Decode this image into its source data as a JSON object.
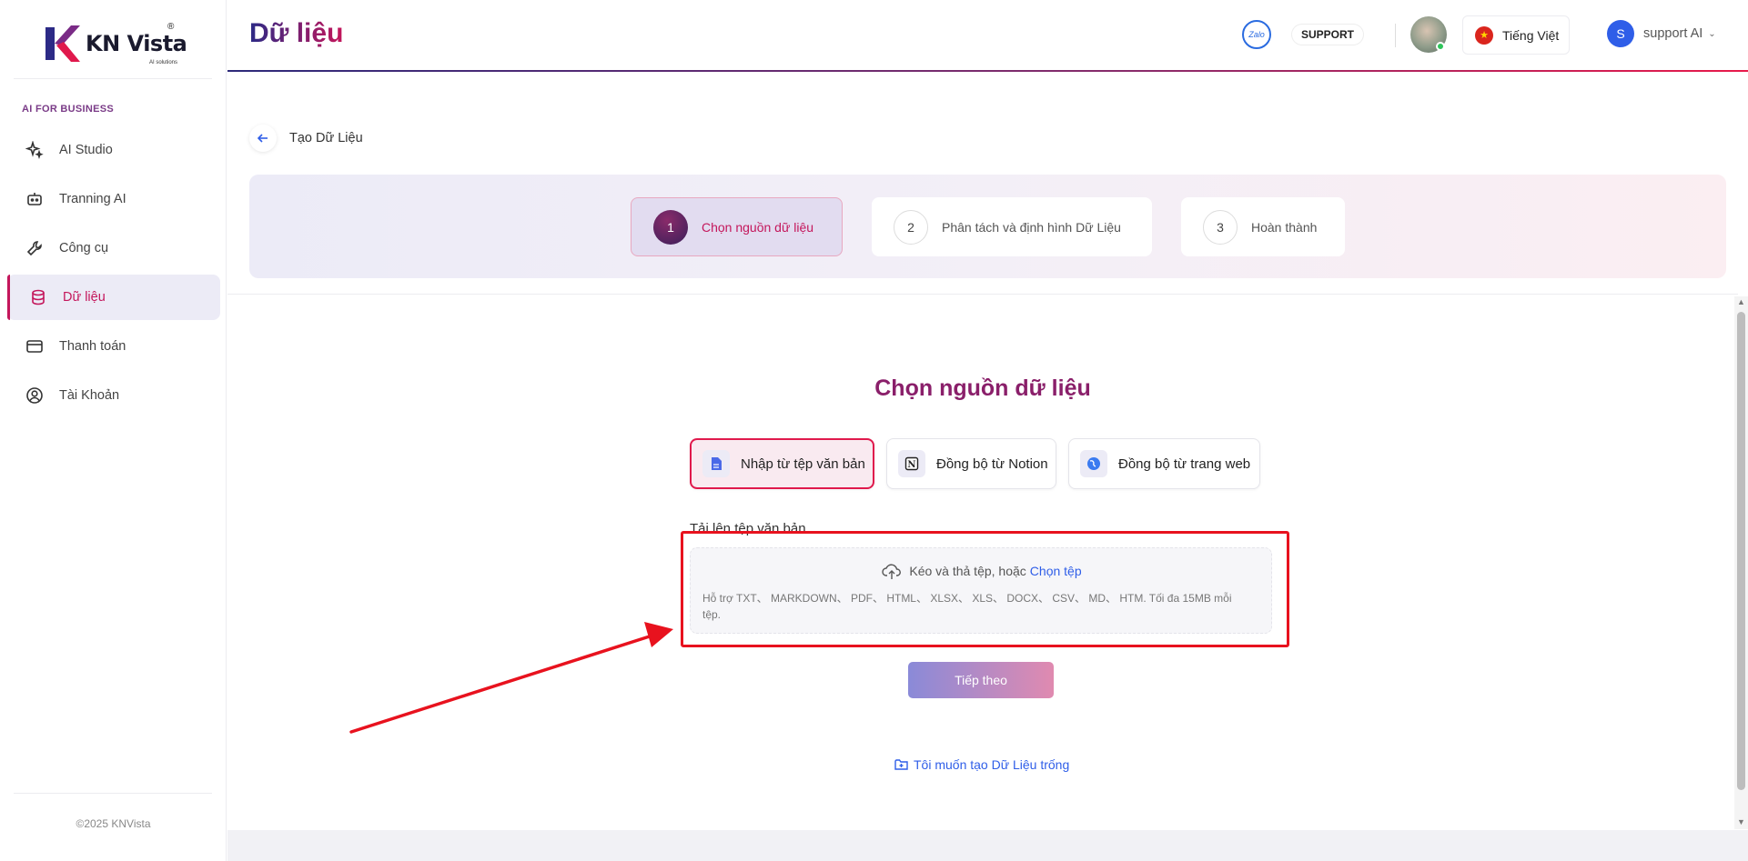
{
  "brand": {
    "name": "KN Vista",
    "tagline": "AI solutions",
    "reg": "®"
  },
  "sidebar": {
    "section_label": "AI FOR BUSINESS",
    "items": [
      {
        "label": "AI Studio",
        "icon": "sparkles-icon",
        "active": false
      },
      {
        "label": "Tranning AI",
        "icon": "robot-icon",
        "active": false
      },
      {
        "label": "Công cụ",
        "icon": "wrench-icon",
        "active": false
      },
      {
        "label": "Dữ liệu",
        "icon": "database-icon",
        "active": true
      },
      {
        "label": "Thanh toán",
        "icon": "credit-card-icon",
        "active": false
      },
      {
        "label": "Tài Khoản",
        "icon": "user-circle-icon",
        "active": false
      }
    ],
    "copyright": "©2025 KNVista"
  },
  "header": {
    "title": "Dữ liệu",
    "zalo_label": "Zalo",
    "support_label": "SUPPORT",
    "language": "Tiếng Việt",
    "user_initial": "S",
    "user_name": "support AI"
  },
  "page": {
    "back_label": "Tạo Dữ Liệu",
    "steps": [
      {
        "num": "1",
        "label": "Chọn nguồn dữ liệu",
        "active": true
      },
      {
        "num": "2",
        "label": "Phân tách và định hình Dữ Liệu",
        "active": false
      },
      {
        "num": "3",
        "label": "Hoàn thành",
        "active": false
      }
    ],
    "section_title": "Chọn nguồn dữ liệu",
    "sources": [
      {
        "label": "Nhập từ tệp văn bản",
        "icon": "file-text-icon",
        "active": true
      },
      {
        "label": "Đồng bộ từ Notion",
        "icon": "notion-icon",
        "active": false
      },
      {
        "label": "Đồng bộ từ trang web",
        "icon": "globe-icon",
        "active": false
      }
    ],
    "upload_label": "Tải lên tệp văn bản",
    "dropzone": {
      "prompt": "Kéo và thả tệp, hoặc",
      "link": "Chọn tệp",
      "hint": "Hỗ trợ TXT、 MARKDOWN、 PDF、 HTML、 XLSX、 XLS、 DOCX、 CSV、 MD、 HTM. Tối đa 15MB mỗi tệp."
    },
    "next_label": "Tiếp theo",
    "empty_link": "Tôi muốn tạo Dữ Liệu trống"
  },
  "colors": {
    "accent": "#c4165b",
    "primary": "#2f5ee8",
    "annotation_red": "#e8121e"
  }
}
